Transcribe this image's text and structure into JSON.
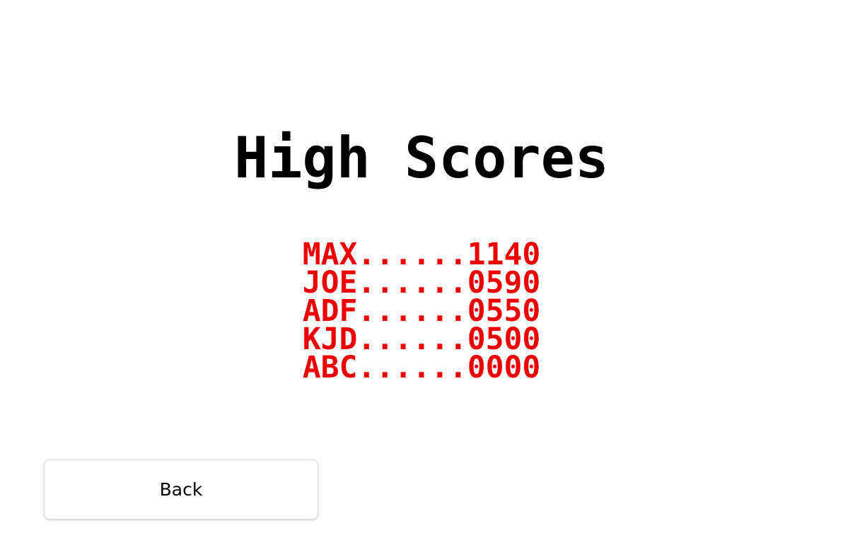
{
  "title": "High Scores",
  "scores": [
    {
      "name": "MAX",
      "dots": "......",
      "score": "1140"
    },
    {
      "name": "JOE",
      "dots": "......",
      "score": "0590"
    },
    {
      "name": "ADF",
      "dots": "......",
      "score": "0550"
    },
    {
      "name": "KJD",
      "dots": "......",
      "score": "0500"
    },
    {
      "name": "ABC",
      "dots": "......",
      "score": "0000"
    }
  ],
  "back_label": "Back",
  "colors": {
    "background": "#ffffff",
    "title": "#000000",
    "score_text": "#ee0000"
  }
}
